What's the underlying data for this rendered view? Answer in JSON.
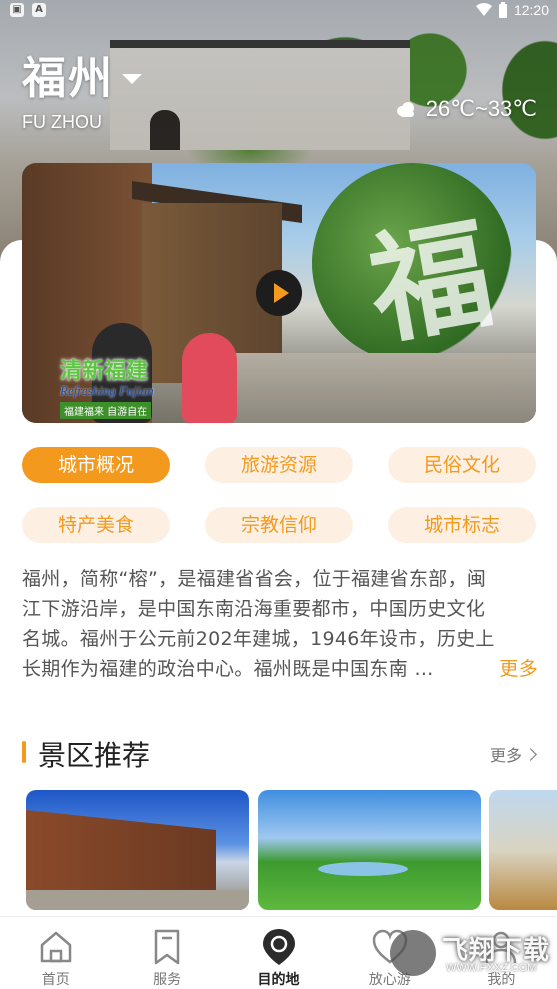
{
  "status_bar": {
    "time": "12:20",
    "icons": [
      "app-notification-icon",
      "warning-a-icon",
      "wifi-icon",
      "battery-icon"
    ]
  },
  "header": {
    "city_name": "福州",
    "city_en": "FU ZHOU",
    "weather_icon": "cloud-icon",
    "temperature": "26℃~33℃"
  },
  "video": {
    "logo_cn": "清新福建",
    "logo_en": "Refreshing Fujian",
    "logo_sub": "福建福来 自游自在",
    "calligraphy": "福"
  },
  "categories": [
    {
      "label": "城市概况",
      "active": true
    },
    {
      "label": "旅游资源",
      "active": false
    },
    {
      "label": "民俗文化",
      "active": false
    },
    {
      "label": "特产美食",
      "active": false
    },
    {
      "label": "宗教信仰",
      "active": false
    },
    {
      "label": "城市标志",
      "active": false
    }
  ],
  "intro": {
    "lines": [
      "福州，简称“榕”，是福建省省会，位于福建省东部，闽",
      "江下游沿岸，是中国东南沿海重要都市，中国历史文化",
      "名城。福州于公元前202年建城，1946年设市，历史上",
      "长期作为福建的政治中心。福州既是中国东南 …"
    ],
    "more": "更多"
  },
  "scenic": {
    "title": "景区推荐",
    "more": "更多"
  },
  "nav": [
    {
      "label": "首页",
      "icon": "home-icon",
      "active": false
    },
    {
      "label": "服务",
      "icon": "bookmark-icon",
      "active": false
    },
    {
      "label": "目的地",
      "icon": "location-pin-icon",
      "active": true
    },
    {
      "label": "放心游",
      "icon": "heart-icon",
      "active": false
    },
    {
      "label": "我的",
      "icon": "user-icon",
      "active": false
    }
  ],
  "watermark": {
    "text": "飞翔下载",
    "url": "WWW.FXXZ.COM"
  },
  "colors": {
    "accent": "#f39a1e",
    "chip_bg": "#fdf0e3"
  }
}
